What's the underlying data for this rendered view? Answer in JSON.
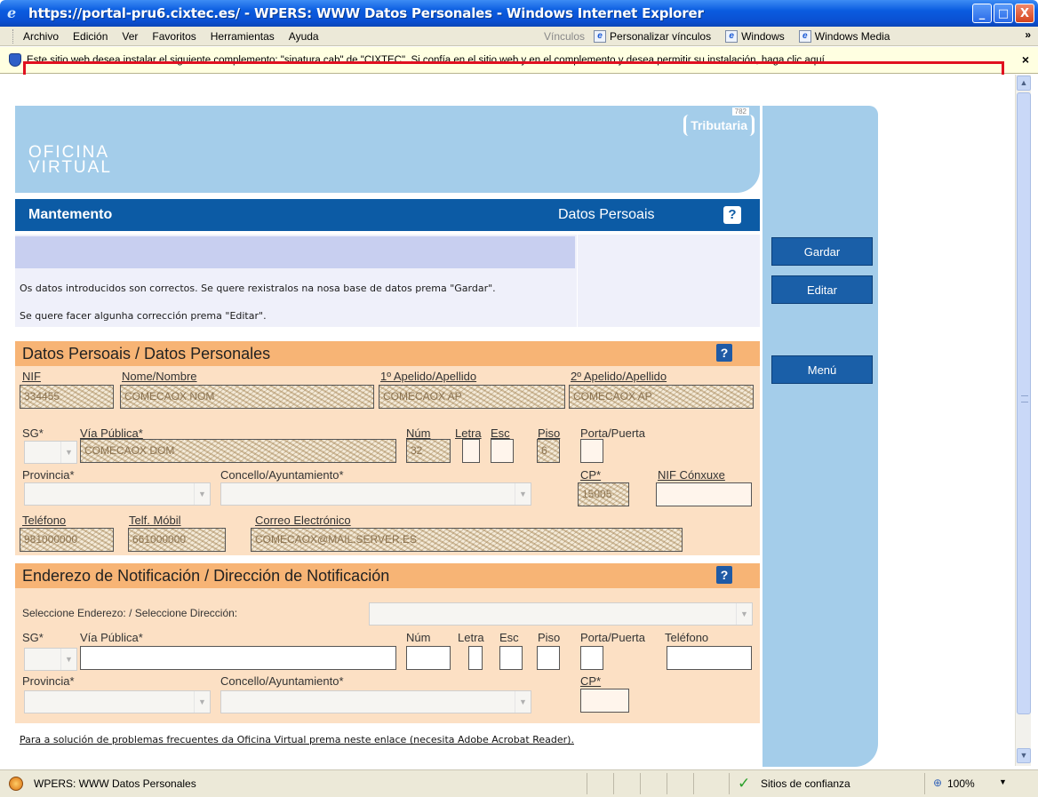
{
  "window": {
    "title": "https://portal-pru6.cixtec.es/ - WPERS: WWW Datos Personales - Windows Internet Explorer",
    "minimize": "_",
    "maximize": "□",
    "close": "X"
  },
  "menu": {
    "items": [
      "Archivo",
      "Edición",
      "Ver",
      "Favoritos",
      "Herramientas",
      "Ayuda"
    ],
    "links_label": "Vínculos",
    "links": [
      "Personalizar vínculos",
      "Windows",
      "Windows Media"
    ],
    "overflow": "»"
  },
  "infobar": {
    "text": "Este sitio web desea instalar el siguiente complemento: \"sinatura.cab\" de \"CIXTEC\". Si confía en el sitio web y en el complemento y desea permitir su instalación, haga clic aquí...",
    "close": "×"
  },
  "banner": {
    "line1": "OFICINA",
    "line2": "VIRTUAL",
    "logo_text": "Tributaria",
    "tiny_code": "782"
  },
  "header": {
    "title": "Mantemento",
    "subtitle": "Datos Persoais",
    "help": "?"
  },
  "messages": {
    "line1": "Os datos introducidos son correctos. Se quere rexistralos na nosa base de datos prema \"Gardar\".",
    "line2": "Se quere facer algunha corrección prema \"Editar\"."
  },
  "side_buttons": {
    "save": "Gardar",
    "edit": "Editar",
    "menu": "Menú"
  },
  "personal": {
    "title": "Datos Persoais / Datos Personales",
    "help": "?",
    "labels": {
      "nif": "NIF",
      "name": "Nome/Nombre",
      "surname1": "1º Apelido/Apellido",
      "surname2": "2º Apelido/Apellido",
      "sg": "SG*",
      "street": "Vía Pública*",
      "num": "Núm",
      "letter": "Letra",
      "stair": "Esc",
      "floor": "Piso",
      "door": "Porta/Puerta",
      "province": "Provincia*",
      "council": "Concello/Ayuntamiento*",
      "cp": "CP*",
      "nif_spouse": "NIF Cónxuxe",
      "phone": "Teléfono",
      "mobile": "Telf. Móbil",
      "email": "Correo Electrónico"
    },
    "values": {
      "nif": "334455",
      "name": "COMECAOX NOM",
      "surname1": "COMECAOX AP",
      "surname2": "COMECAOX AP",
      "street": "COMECAOX DOM",
      "num": "32",
      "floor": "6",
      "cp": "15005",
      "phone": "981000000",
      "mobile": "661000000",
      "email": "COMECAOX@MAIL.SERVER.ES"
    }
  },
  "notification": {
    "title": "Enderezo de Notificación / Dirección de Notificación",
    "help": "?",
    "labels": {
      "select_address": "Seleccione Enderezo:  / Seleccione Dirección:",
      "sg": "SG*",
      "street": "Vía Pública*",
      "num": "Núm",
      "letter": "Letra",
      "stair": "Esc",
      "floor": "Piso",
      "door": "Porta/Puerta",
      "phone": "Teléfono",
      "province": "Provincia*",
      "council": "Concello/Ayuntamiento*",
      "cp": "CP*"
    }
  },
  "footer": {
    "link": "Para a solución de problemas frecuentes da Oficina Virtual prema neste enlace (necesita Adobe Acrobat Reader)."
  },
  "status": {
    "text": "WPERS: WWW Datos Personales",
    "zone": "Sitios de confianza",
    "zoom": "100%"
  }
}
